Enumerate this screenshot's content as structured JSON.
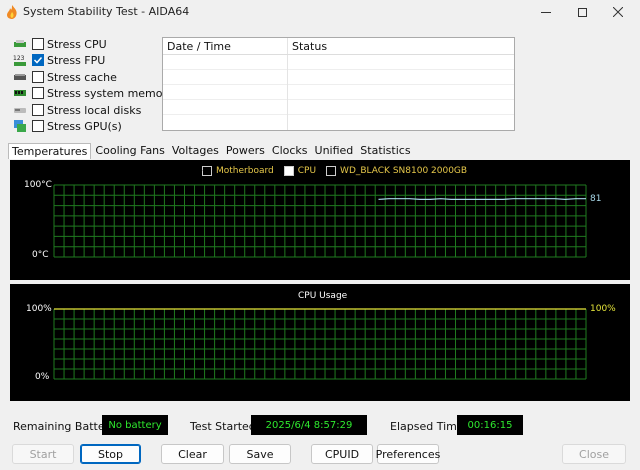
{
  "window": {
    "title": "System Stability Test - AIDA64",
    "controls": [
      "minimize-icon",
      "maximize-icon",
      "close-icon"
    ]
  },
  "stress_options": [
    {
      "label": "Stress CPU",
      "checked": false,
      "icon": "cpu-icon"
    },
    {
      "label": "Stress FPU",
      "checked": true,
      "icon": "fpu-123-icon"
    },
    {
      "label": "Stress cache",
      "checked": false,
      "icon": "cache-icon"
    },
    {
      "label": "Stress system memory",
      "checked": false,
      "icon": "memory-icon"
    },
    {
      "label": "Stress local disks",
      "checked": false,
      "icon": "disk-icon"
    },
    {
      "label": "Stress GPU(s)",
      "checked": false,
      "icon": "gpu-icon"
    }
  ],
  "log": {
    "columns": [
      "Date / Time",
      "Status"
    ],
    "rows": []
  },
  "tabs": [
    "Temperatures",
    "Cooling Fans",
    "Voltages",
    "Powers",
    "Clocks",
    "Unified",
    "Statistics"
  ],
  "active_tab": "Temperatures",
  "temperature_graph": {
    "legend": [
      {
        "label": "Motherboard",
        "checked": false
      },
      {
        "label": "CPU",
        "checked": true
      },
      {
        "label": "WD_BLACK SN8100 2000GB",
        "checked": false
      }
    ],
    "y_max_label": "100°C",
    "y_min_label": "0°C",
    "current_value": "81",
    "line_color": "#a8d8e8"
  },
  "cpu_graph": {
    "title": "CPU Usage",
    "y_max_label": "100%",
    "y_min_label": "0%",
    "current_value": "100%",
    "line_color": "#e6e63a"
  },
  "chart_data": [
    {
      "type": "line",
      "title": "",
      "ylim": [
        0,
        100
      ],
      "series": [
        {
          "name": "CPU",
          "values": [
            80,
            81,
            81,
            81,
            80,
            80,
            81,
            80,
            80,
            80,
            80,
            80,
            80,
            81,
            81,
            81,
            81,
            81,
            80,
            81,
            81
          ]
        }
      ],
      "x": [
        0,
        5,
        10,
        15,
        20,
        25,
        30,
        35,
        40,
        45,
        50,
        55,
        60,
        65,
        70,
        75,
        80,
        85,
        90,
        95,
        100
      ]
    },
    {
      "type": "line",
      "title": "CPU Usage",
      "ylim": [
        0,
        100
      ],
      "series": [
        {
          "name": "",
          "values": [
            100,
            100,
            100,
            100,
            100,
            100,
            100,
            100,
            100,
            100,
            100
          ]
        }
      ],
      "x": [
        0,
        10,
        20,
        30,
        40,
        50,
        60,
        70,
        80,
        90,
        100
      ]
    }
  ],
  "status": {
    "remaining_battery_label": "Remaining Battery:",
    "remaining_battery_value": "No battery",
    "test_started_label": "Test Started:",
    "test_started_value": "2025/6/4 8:57:29",
    "elapsed_label": "Elapsed Time:",
    "elapsed_value": "00:16:15"
  },
  "buttons": {
    "start": "Start",
    "stop": "Stop",
    "clear": "Clear",
    "save": "Save",
    "cpuid": "CPUID",
    "preferences": "Preferences",
    "close": "Close"
  },
  "colors": {
    "grid": "#1f7a1f",
    "graph_bg": "#000000",
    "status_text": "#2ee82e",
    "accent": "#0067c0"
  }
}
